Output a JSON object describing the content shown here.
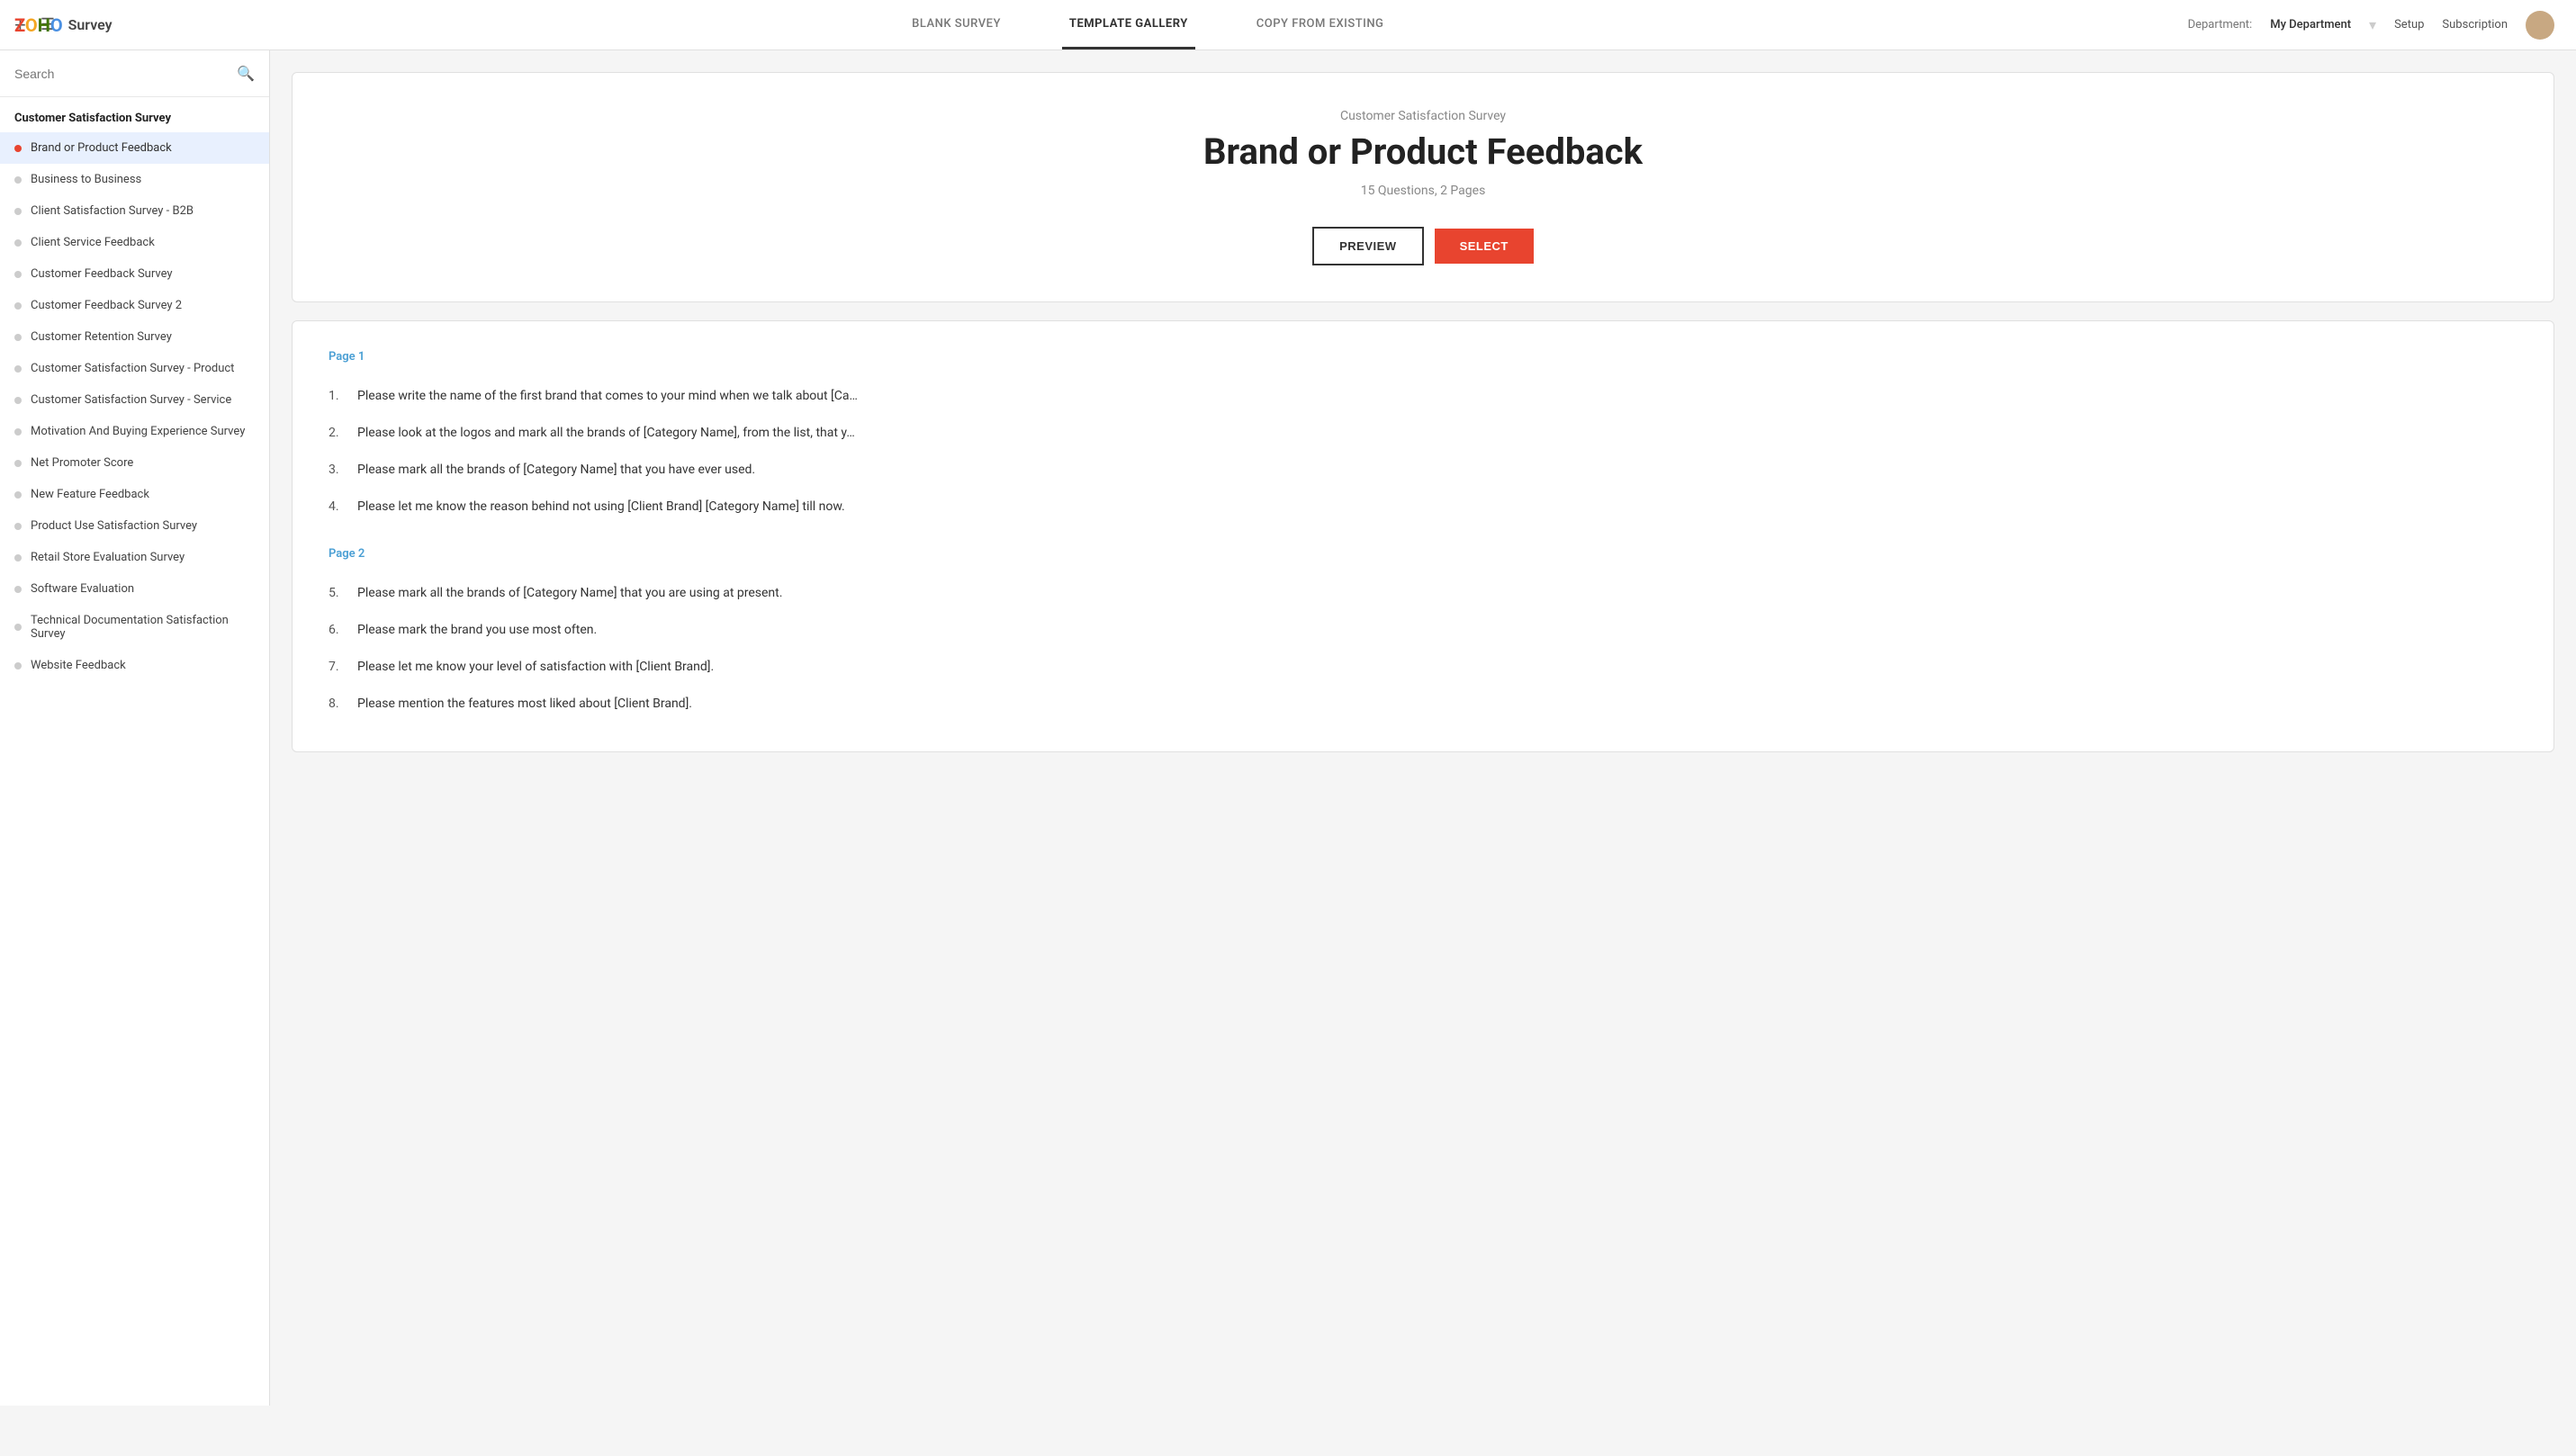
{
  "header": {
    "logo_text": "Survey",
    "department_label": "Department:",
    "department_value": "My Department",
    "setup_link": "Setup",
    "subscription_link": "Subscription"
  },
  "nav_tabs": [
    {
      "id": "blank",
      "label": "BLANK SURVEY",
      "active": false
    },
    {
      "id": "template",
      "label": "TEMPLATE GALLERY",
      "active": true
    },
    {
      "id": "copy",
      "label": "COPY FROM EXISTING",
      "active": false
    }
  ],
  "search": {
    "placeholder": "Search"
  },
  "sidebar": {
    "section_title": "Customer Satisfaction Survey",
    "items": [
      {
        "id": "brand",
        "label": "Brand or Product Feedback",
        "active": true
      },
      {
        "id": "b2b",
        "label": "Business to Business",
        "active": false
      },
      {
        "id": "client-b2b",
        "label": "Client Satisfaction Survey - B2B",
        "active": false
      },
      {
        "id": "client-service",
        "label": "Client Service Feedback",
        "active": false
      },
      {
        "id": "cust-feedback",
        "label": "Customer Feedback Survey",
        "active": false
      },
      {
        "id": "cust-feedback2",
        "label": "Customer Feedback Survey 2",
        "active": false
      },
      {
        "id": "cust-retention",
        "label": "Customer Retention Survey",
        "active": false
      },
      {
        "id": "cust-sat-product",
        "label": "Customer Satisfaction Survey - Product",
        "active": false
      },
      {
        "id": "cust-sat-service",
        "label": "Customer Satisfaction Survey - Service",
        "active": false
      },
      {
        "id": "motivation",
        "label": "Motivation And Buying Experience Survey",
        "active": false
      },
      {
        "id": "nps",
        "label": "Net Promoter Score",
        "active": false
      },
      {
        "id": "new-feature",
        "label": "New Feature Feedback",
        "active": false
      },
      {
        "id": "product-use",
        "label": "Product Use Satisfaction Survey",
        "active": false
      },
      {
        "id": "retail",
        "label": "Retail Store Evaluation Survey",
        "active": false
      },
      {
        "id": "software",
        "label": "Software Evaluation",
        "active": false
      },
      {
        "id": "tech-doc",
        "label": "Technical Documentation Satisfaction Survey",
        "active": false
      },
      {
        "id": "website",
        "label": "Website Feedback",
        "active": false
      }
    ]
  },
  "preview": {
    "category": "Customer Satisfaction Survey",
    "title": "Brand or Product Feedback",
    "meta": "15 Questions, 2 Pages",
    "preview_btn": "PREVIEW",
    "select_btn": "SELECT"
  },
  "questions": {
    "pages": [
      {
        "label": "Page 1",
        "items": [
          "Please write the name of the first brand that comes to your mind when we talk about [Ca…",
          "Please look at the logos and mark all the brands of [Category Name], from the list, that y…",
          "Please mark all the brands of [Category Name] that you have ever used.",
          "Please let me know the reason behind not using [Client Brand] [Category Name] till now."
        ]
      },
      {
        "label": "Page 2",
        "items": [
          "Please mark all the brands of [Category Name] that you are using at present.",
          "Please mark the brand you use most often.",
          "Please let me know your level of satisfaction with [Client Brand].",
          "Please mention the features most liked about [Client Brand]."
        ]
      }
    ]
  }
}
